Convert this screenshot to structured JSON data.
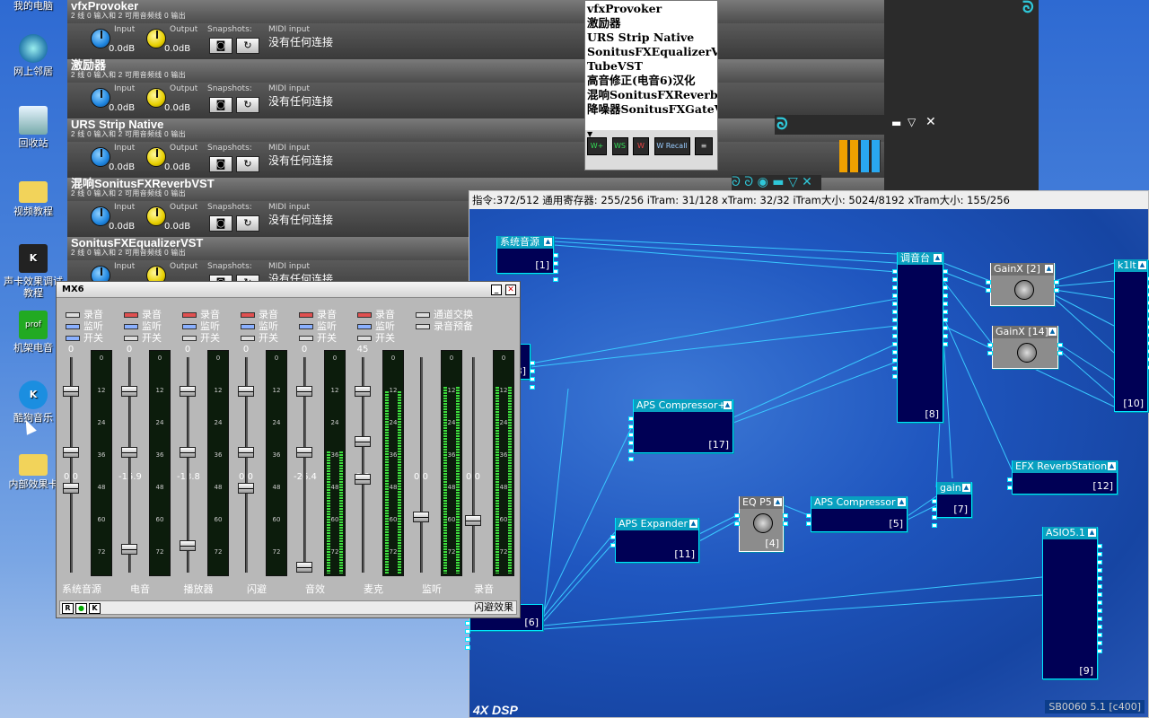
{
  "desktop": {
    "icons": [
      {
        "label": "我的电脑",
        "icon": "my-computer-icon"
      },
      {
        "label": "网上邻居",
        "icon": "network-icon"
      },
      {
        "label": "回收站",
        "icon": "recycle-bin-icon"
      },
      {
        "label": "视频教程",
        "icon": "folder-icon"
      },
      {
        "label": "声卡效果调试教程",
        "icon": "shortcut-icon"
      },
      {
        "label": "机架电音",
        "icon": "professor-icon"
      },
      {
        "label": "酷狗音乐",
        "icon": "kugou-icon"
      },
      {
        "label": "内部效果卡",
        "icon": "folder-icon"
      }
    ]
  },
  "host": {
    "sublabel": "2 线 0 输入和 2 可用音频线 0 输出",
    "input_label": "Input",
    "output_label": "Output",
    "snap_label": "Snapshots:",
    "midi_label": "MIDI input",
    "midi_value": "没有任何连接",
    "gain_value": "0.0dB",
    "plugins": [
      {
        "name": "vfxProvoker"
      },
      {
        "name": "激励器"
      },
      {
        "name": "URS Strip Native"
      },
      {
        "name": "混响SonitusFXReverbVST"
      },
      {
        "name": "SonitusFXEqualizerVST"
      }
    ]
  },
  "menu": {
    "items": [
      "vfxProvoker",
      "激励器",
      "URS Strip Native",
      "SonitusFXEqualizerVST",
      "TubeVST",
      "高音修正(电音6)汉化",
      "混响SonitusFXReverbVST",
      "降噪器SonitusFXGateVST"
    ],
    "tools": [
      "W+",
      "WS",
      "W",
      "W Recall",
      "≡"
    ]
  },
  "dsp": {
    "status": "指令:372/512 通用寄存器: 255/256 iTram: 31/128 xTram: 32/32 iTram大小: 5024/8192 xTram大小: 155/256",
    "brand": "4X DSP",
    "version": "SB0060 5.1 [c400]",
    "nodes": [
      {
        "title": "系统音源",
        "id": "[1]"
      },
      {
        "title": "调音台",
        "id": "[8]"
      },
      {
        "title": "GainX [2]",
        "id": ""
      },
      {
        "title": "GainX [14]",
        "id": ""
      },
      {
        "title": "k1lt",
        "id": "[10]"
      },
      {
        "title": "",
        "id": "[3]"
      },
      {
        "title": "APS Compressor+",
        "id": "[17]"
      },
      {
        "title": "EFX ReverbStation",
        "id": "[12]"
      },
      {
        "title": "gain",
        "id": "[7]"
      },
      {
        "title": "EQ P5",
        "id": "[4]"
      },
      {
        "title": "APS Compressor",
        "id": "[5]"
      },
      {
        "title": "APS Expander",
        "id": "[11]"
      },
      {
        "title": "ASIO5.1",
        "id": "[9]"
      },
      {
        "title": "",
        "id": "[6]"
      }
    ]
  },
  "mixer": {
    "title": "MX6",
    "check_labels": [
      "录音",
      "监听",
      "开关"
    ],
    "extra_labels": [
      "通道交换",
      "录音预备"
    ],
    "footer_right": "闪避效果",
    "footer_buttons": [
      "R",
      "●",
      "K"
    ],
    "ticks": [
      "0",
      "12",
      "24",
      "36",
      "48",
      "60",
      "72"
    ],
    "channels": [
      {
        "name": "系统音源",
        "top": "0",
        "bottom": "0.0",
        "level": 0
      },
      {
        "name": "电音",
        "top": "0",
        "bottom": "-15.9",
        "level": 0
      },
      {
        "name": "播放器",
        "top": "0",
        "bottom": "-13.8",
        "level": 0
      },
      {
        "name": "闪避",
        "top": "0",
        "bottom": "0.0",
        "level": 0
      },
      {
        "name": "音效",
        "top": "0",
        "bottom": "-26.4",
        "level": 0.55
      },
      {
        "name": "麦克",
        "top": "45",
        "bottom": "0.0",
        "level": 0.82
      },
      {
        "name": "监听",
        "top": "",
        "bottom": "0.0",
        "level": 0.84
      },
      {
        "name": "录音",
        "top": "",
        "bottom": "0.0",
        "level": 0.84
      }
    ]
  }
}
